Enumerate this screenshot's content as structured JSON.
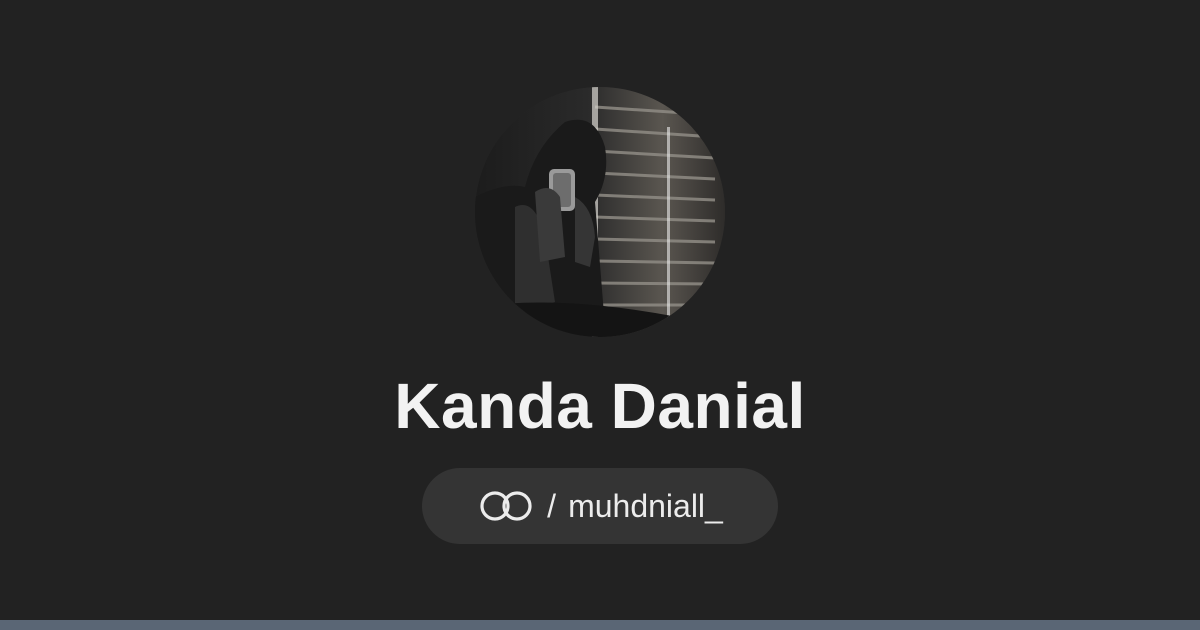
{
  "profile": {
    "display_name": "Kanda Danial",
    "avatar_icon": "profile-photo",
    "link": {
      "icon": "threads-link-icon",
      "separator": "/",
      "handle": "muhdniall_"
    }
  },
  "colors": {
    "background": "#222222",
    "pill_background": "#343434",
    "text": "#f2f2f2",
    "bottom_bar": "#5a6675"
  }
}
